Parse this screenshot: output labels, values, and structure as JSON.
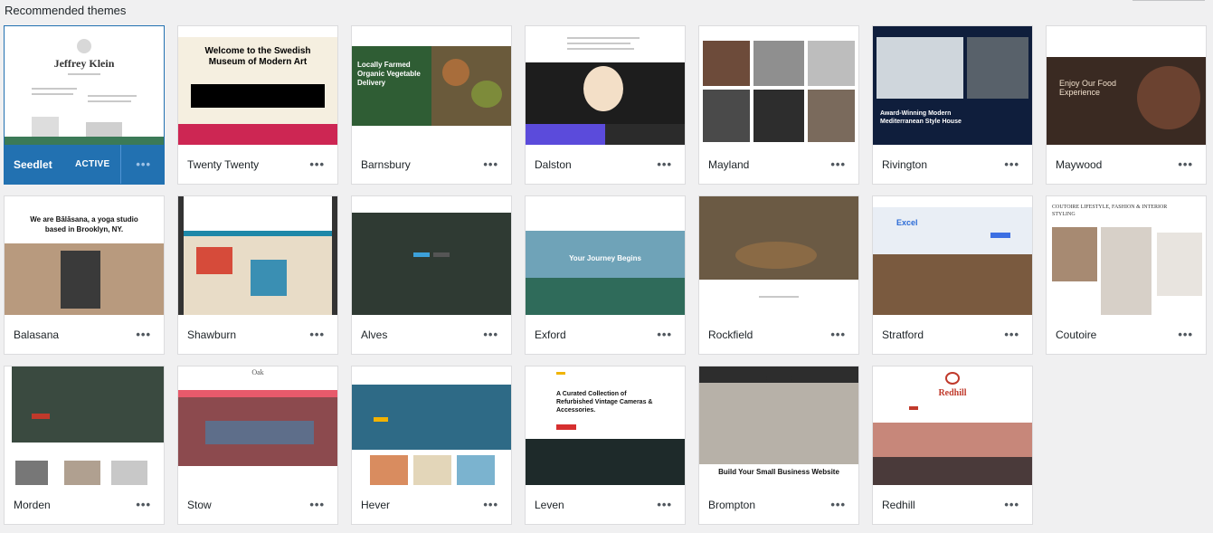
{
  "header": {
    "title": "Recommended themes"
  },
  "active_label": "ACTIVE",
  "more_glyph": "•••",
  "colors": {
    "accent": "#2271b1",
    "background": "#f0f0f1"
  },
  "thumbs": {
    "seedlet_title": "Jeffrey Klein",
    "twentytwenty_title": "Welcome to the Swedish Museum of Modern Art",
    "barnsbury_title": "Locally Farmed Organic Vegetable Delivery",
    "maywood_title": "Enjoy Our Food Experience",
    "rivington_title": "Award-Winning Modern Mediterranean Style House",
    "balasana_title": "We are Bālāsana, a yoga studio based in Brooklyn, NY.",
    "exford_title": "Your Journey Begins",
    "stratford_title": "Excel",
    "coutoire_title": "COUTOIRE LIFESTYLE, FASHION & INTERIOR STYLING",
    "stow_title": "Oak",
    "leven_title": "A Curated Collection of Refurbished Vintage Cameras & Accessories.",
    "brompton_title": "Build Your Small Business Website",
    "redhill_title": "Redhill"
  },
  "themes": [
    {
      "name": "Seedlet",
      "active": true
    },
    {
      "name": "Twenty Twenty"
    },
    {
      "name": "Barnsbury"
    },
    {
      "name": "Dalston"
    },
    {
      "name": "Mayland"
    },
    {
      "name": "Rivington"
    },
    {
      "name": "Maywood"
    },
    {
      "name": "Balasana"
    },
    {
      "name": "Shawburn"
    },
    {
      "name": "Alves"
    },
    {
      "name": "Exford"
    },
    {
      "name": "Rockfield"
    },
    {
      "name": "Stratford"
    },
    {
      "name": "Coutoire"
    },
    {
      "name": "Morden"
    },
    {
      "name": "Stow"
    },
    {
      "name": "Hever"
    },
    {
      "name": "Leven"
    },
    {
      "name": "Brompton"
    },
    {
      "name": "Redhill"
    }
  ]
}
